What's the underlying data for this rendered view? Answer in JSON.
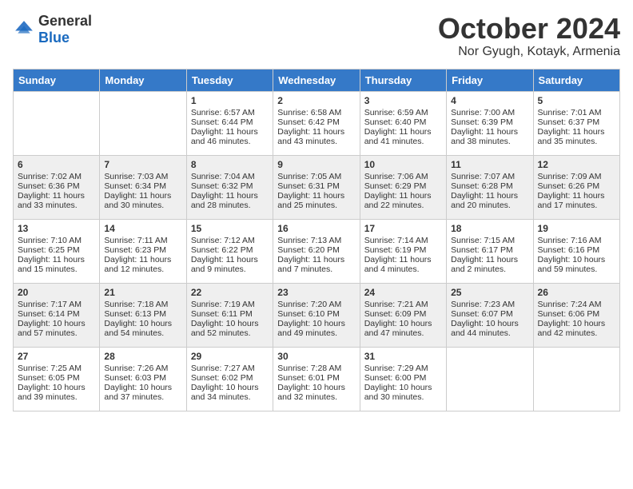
{
  "logo": {
    "general": "General",
    "blue": "Blue"
  },
  "title": "October 2024",
  "location": "Nor Gyugh, Kotayk, Armenia",
  "days_of_week": [
    "Sunday",
    "Monday",
    "Tuesday",
    "Wednesday",
    "Thursday",
    "Friday",
    "Saturday"
  ],
  "weeks": [
    [
      {
        "day": "",
        "sunrise": "",
        "sunset": "",
        "daylight": ""
      },
      {
        "day": "",
        "sunrise": "",
        "sunset": "",
        "daylight": ""
      },
      {
        "day": "1",
        "sunrise": "Sunrise: 6:57 AM",
        "sunset": "Sunset: 6:44 PM",
        "daylight": "Daylight: 11 hours and 46 minutes."
      },
      {
        "day": "2",
        "sunrise": "Sunrise: 6:58 AM",
        "sunset": "Sunset: 6:42 PM",
        "daylight": "Daylight: 11 hours and 43 minutes."
      },
      {
        "day": "3",
        "sunrise": "Sunrise: 6:59 AM",
        "sunset": "Sunset: 6:40 PM",
        "daylight": "Daylight: 11 hours and 41 minutes."
      },
      {
        "day": "4",
        "sunrise": "Sunrise: 7:00 AM",
        "sunset": "Sunset: 6:39 PM",
        "daylight": "Daylight: 11 hours and 38 minutes."
      },
      {
        "day": "5",
        "sunrise": "Sunrise: 7:01 AM",
        "sunset": "Sunset: 6:37 PM",
        "daylight": "Daylight: 11 hours and 35 minutes."
      }
    ],
    [
      {
        "day": "6",
        "sunrise": "Sunrise: 7:02 AM",
        "sunset": "Sunset: 6:36 PM",
        "daylight": "Daylight: 11 hours and 33 minutes."
      },
      {
        "day": "7",
        "sunrise": "Sunrise: 7:03 AM",
        "sunset": "Sunset: 6:34 PM",
        "daylight": "Daylight: 11 hours and 30 minutes."
      },
      {
        "day": "8",
        "sunrise": "Sunrise: 7:04 AM",
        "sunset": "Sunset: 6:32 PM",
        "daylight": "Daylight: 11 hours and 28 minutes."
      },
      {
        "day": "9",
        "sunrise": "Sunrise: 7:05 AM",
        "sunset": "Sunset: 6:31 PM",
        "daylight": "Daylight: 11 hours and 25 minutes."
      },
      {
        "day": "10",
        "sunrise": "Sunrise: 7:06 AM",
        "sunset": "Sunset: 6:29 PM",
        "daylight": "Daylight: 11 hours and 22 minutes."
      },
      {
        "day": "11",
        "sunrise": "Sunrise: 7:07 AM",
        "sunset": "Sunset: 6:28 PM",
        "daylight": "Daylight: 11 hours and 20 minutes."
      },
      {
        "day": "12",
        "sunrise": "Sunrise: 7:09 AM",
        "sunset": "Sunset: 6:26 PM",
        "daylight": "Daylight: 11 hours and 17 minutes."
      }
    ],
    [
      {
        "day": "13",
        "sunrise": "Sunrise: 7:10 AM",
        "sunset": "Sunset: 6:25 PM",
        "daylight": "Daylight: 11 hours and 15 minutes."
      },
      {
        "day": "14",
        "sunrise": "Sunrise: 7:11 AM",
        "sunset": "Sunset: 6:23 PM",
        "daylight": "Daylight: 11 hours and 12 minutes."
      },
      {
        "day": "15",
        "sunrise": "Sunrise: 7:12 AM",
        "sunset": "Sunset: 6:22 PM",
        "daylight": "Daylight: 11 hours and 9 minutes."
      },
      {
        "day": "16",
        "sunrise": "Sunrise: 7:13 AM",
        "sunset": "Sunset: 6:20 PM",
        "daylight": "Daylight: 11 hours and 7 minutes."
      },
      {
        "day": "17",
        "sunrise": "Sunrise: 7:14 AM",
        "sunset": "Sunset: 6:19 PM",
        "daylight": "Daylight: 11 hours and 4 minutes."
      },
      {
        "day": "18",
        "sunrise": "Sunrise: 7:15 AM",
        "sunset": "Sunset: 6:17 PM",
        "daylight": "Daylight: 11 hours and 2 minutes."
      },
      {
        "day": "19",
        "sunrise": "Sunrise: 7:16 AM",
        "sunset": "Sunset: 6:16 PM",
        "daylight": "Daylight: 10 hours and 59 minutes."
      }
    ],
    [
      {
        "day": "20",
        "sunrise": "Sunrise: 7:17 AM",
        "sunset": "Sunset: 6:14 PM",
        "daylight": "Daylight: 10 hours and 57 minutes."
      },
      {
        "day": "21",
        "sunrise": "Sunrise: 7:18 AM",
        "sunset": "Sunset: 6:13 PM",
        "daylight": "Daylight: 10 hours and 54 minutes."
      },
      {
        "day": "22",
        "sunrise": "Sunrise: 7:19 AM",
        "sunset": "Sunset: 6:11 PM",
        "daylight": "Daylight: 10 hours and 52 minutes."
      },
      {
        "day": "23",
        "sunrise": "Sunrise: 7:20 AM",
        "sunset": "Sunset: 6:10 PM",
        "daylight": "Daylight: 10 hours and 49 minutes."
      },
      {
        "day": "24",
        "sunrise": "Sunrise: 7:21 AM",
        "sunset": "Sunset: 6:09 PM",
        "daylight": "Daylight: 10 hours and 47 minutes."
      },
      {
        "day": "25",
        "sunrise": "Sunrise: 7:23 AM",
        "sunset": "Sunset: 6:07 PM",
        "daylight": "Daylight: 10 hours and 44 minutes."
      },
      {
        "day": "26",
        "sunrise": "Sunrise: 7:24 AM",
        "sunset": "Sunset: 6:06 PM",
        "daylight": "Daylight: 10 hours and 42 minutes."
      }
    ],
    [
      {
        "day": "27",
        "sunrise": "Sunrise: 7:25 AM",
        "sunset": "Sunset: 6:05 PM",
        "daylight": "Daylight: 10 hours and 39 minutes."
      },
      {
        "day": "28",
        "sunrise": "Sunrise: 7:26 AM",
        "sunset": "Sunset: 6:03 PM",
        "daylight": "Daylight: 10 hours and 37 minutes."
      },
      {
        "day": "29",
        "sunrise": "Sunrise: 7:27 AM",
        "sunset": "Sunset: 6:02 PM",
        "daylight": "Daylight: 10 hours and 34 minutes."
      },
      {
        "day": "30",
        "sunrise": "Sunrise: 7:28 AM",
        "sunset": "Sunset: 6:01 PM",
        "daylight": "Daylight: 10 hours and 32 minutes."
      },
      {
        "day": "31",
        "sunrise": "Sunrise: 7:29 AM",
        "sunset": "Sunset: 6:00 PM",
        "daylight": "Daylight: 10 hours and 30 minutes."
      },
      {
        "day": "",
        "sunrise": "",
        "sunset": "",
        "daylight": ""
      },
      {
        "day": "",
        "sunrise": "",
        "sunset": "",
        "daylight": ""
      }
    ]
  ]
}
